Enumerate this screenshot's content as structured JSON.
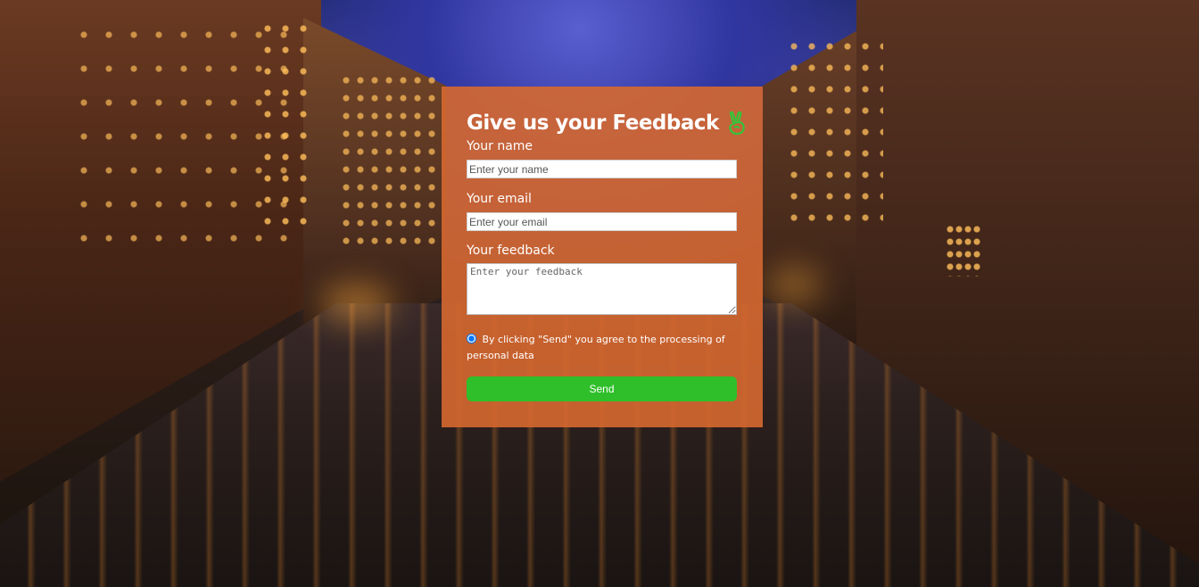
{
  "colors": {
    "panel": "#d66830",
    "send_button": "#2fbf2a",
    "hand_icon": "#35c43a"
  },
  "icons": {
    "title_icon": "victory-hand-icon"
  },
  "form": {
    "title": "Give us your Feedback",
    "name_label": "Your name",
    "name_placeholder": "Enter your name",
    "email_label": "Your email",
    "email_placeholder": "Enter your email",
    "feedback_label": "Your feedback",
    "feedback_placeholder": "Enter your feedback",
    "consent_text": "By clicking \"Send\" you agree to the processing of personal data",
    "send_label": "Send"
  }
}
